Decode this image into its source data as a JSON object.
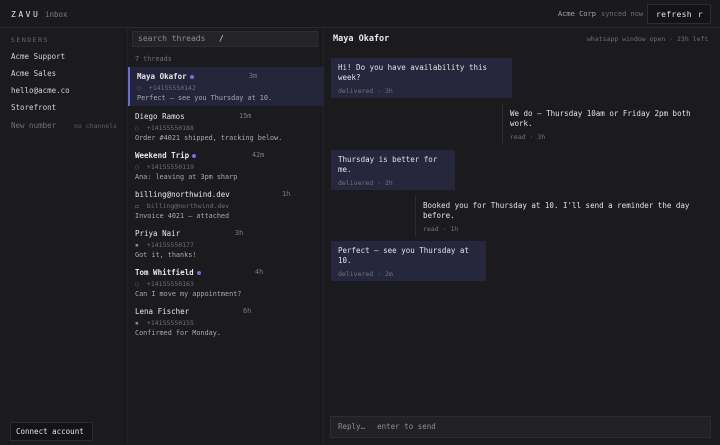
{
  "app": {
    "logo": "ZAVU",
    "section": "inbox"
  },
  "topbar": {
    "workspace": "Acme Corp",
    "sync": "synced now",
    "refresh_label": "refresh",
    "refresh_key": "r"
  },
  "senders": {
    "heading": "SENDERS",
    "items": [
      "Acme Support",
      "Acme Sales",
      "hello@acme.co",
      "Storefront"
    ],
    "new_label": "New number",
    "new_note": "no channels"
  },
  "connect_label": "Connect account",
  "search": {
    "placeholder": "search threads",
    "shortcut": "/"
  },
  "thread_count": "7 threads",
  "threads": [
    {
      "name": "Maya Okafor",
      "time": "3m",
      "channel_icon": "whatsapp-icon",
      "channel_glyph": "◌",
      "address": "+14155550142",
      "preview": "Perfect — see you Thursday at 10.",
      "unread": true,
      "active": true
    },
    {
      "name": "Diego Ramos",
      "time": "15m",
      "channel_icon": "whatsapp-icon",
      "channel_glyph": "◌",
      "address": "+14155550188",
      "preview": "Order #4021 shipped, tracking below.",
      "unread": false,
      "active": false
    },
    {
      "name": "Weekend Trip",
      "time": "42m",
      "channel_icon": "whatsapp-icon",
      "channel_glyph": "◌",
      "address": "+14155550119",
      "preview": "Ana: leaving at 3pm sharp",
      "unread": true,
      "active": false
    },
    {
      "name": "billing@northwind.dev",
      "time": "1h",
      "channel_icon": "email-icon",
      "channel_glyph": "▭",
      "address": "billing@northwind.dev",
      "preview": "Invoice 4021 — attached",
      "unread": false,
      "active": false
    },
    {
      "name": "Priya Nair",
      "time": "3h",
      "channel_icon": "sms-icon",
      "channel_glyph": "▪",
      "address": "+14155550177",
      "preview": "Got it, thanks!",
      "unread": false,
      "active": false
    },
    {
      "name": "Tom Whitfield",
      "time": "4h",
      "channel_icon": "whatsapp-icon",
      "channel_glyph": "◌",
      "address": "+14155550163",
      "preview": "Can I move my appointment?",
      "unread": true,
      "active": false
    },
    {
      "name": "Lena Fischer",
      "time": "6h",
      "channel_icon": "sms-icon",
      "channel_glyph": "▪",
      "address": "+14155550155",
      "preview": "Confirmed for Monday.",
      "unread": false,
      "active": false
    }
  ],
  "conversation": {
    "title": "Maya Okafor",
    "channel": "whatsapp",
    "window": "window open · 23h left",
    "messages": [
      {
        "direction": "out",
        "lines": [
          "Hi! Do you have availability this",
          "week?"
        ],
        "status": "delivered · 3h"
      },
      {
        "direction": "in",
        "lines": [
          "We do — Thursday 10am or Friday 2pm both",
          "work."
        ],
        "status": "read · 3h"
      },
      {
        "direction": "out",
        "lines": [
          "Thursday is better for",
          "me."
        ],
        "status": "delivered · 2h"
      },
      {
        "direction": "in",
        "lines": [
          "Booked you for Thursday at 10. I'll send a reminder the day",
          "before."
        ],
        "status": "read · 1h"
      },
      {
        "direction": "out",
        "lines": [
          "Perfect — see you Thursday at",
          "10."
        ],
        "status": "delivered · 2m"
      }
    ]
  },
  "composer": {
    "placeholder": "Reply…",
    "hint": "enter to send"
  },
  "colors": {
    "accent": "#6f6ff0",
    "outgoing_bubble": "#26263c",
    "active_thread": "#25253a",
    "background": "#1b1b1e"
  }
}
